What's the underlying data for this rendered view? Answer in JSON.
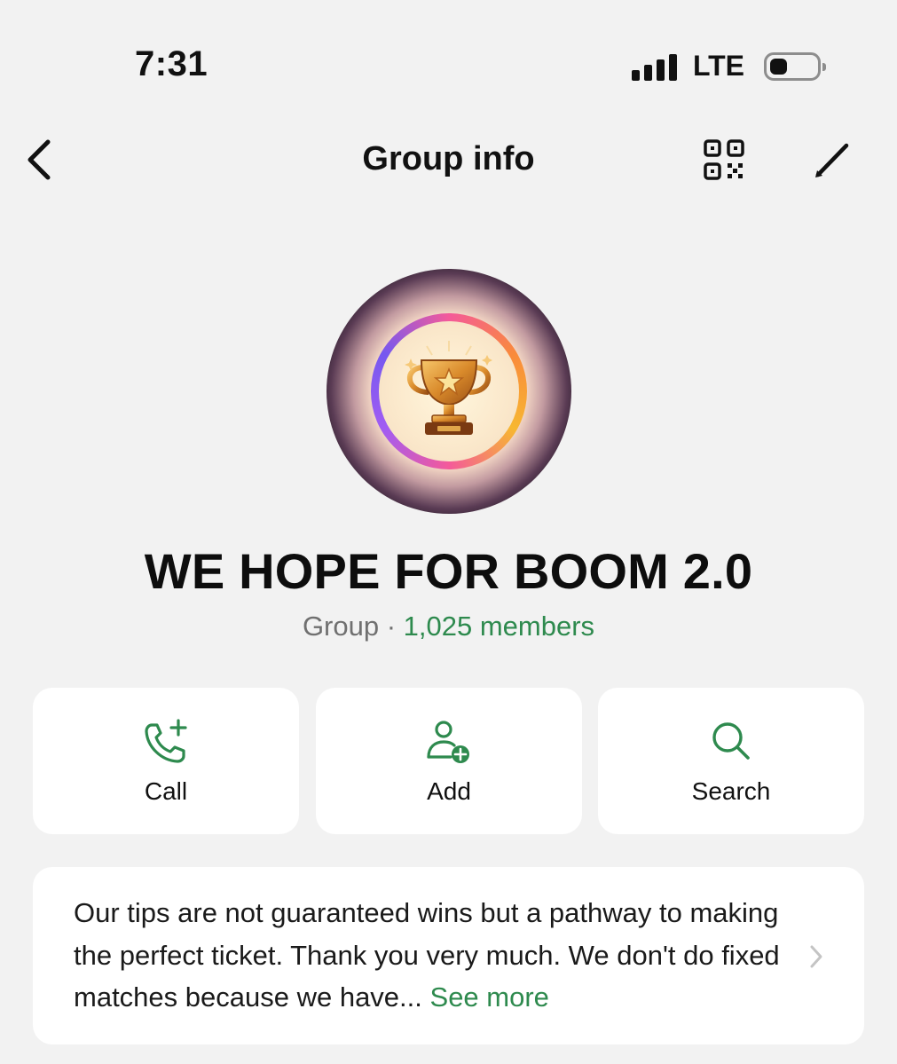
{
  "status_bar": {
    "time": "7:31",
    "network": "LTE"
  },
  "header": {
    "title": "Group info",
    "back_icon": "chevron-left-icon",
    "qr_icon": "qr-code-icon",
    "edit_icon": "pencil-icon"
  },
  "group": {
    "name": "WE HOPE FOR BOOM 2.0",
    "type_label": "Group",
    "separator": " · ",
    "members": "1,025 members",
    "avatar_icon": "trophy-icon"
  },
  "actions": [
    {
      "label": "Call",
      "icon": "phone-add-icon"
    },
    {
      "label": "Add",
      "icon": "add-person-icon"
    },
    {
      "label": "Search",
      "icon": "search-icon"
    }
  ],
  "description": {
    "text": "Our tips are not guaranteed wins but a pathway to making the perfect ticket. Thank you very much. We don't do fixed matches because we have...",
    "see_more": "See more"
  },
  "colors": {
    "accent": "#2e8a4e",
    "background": "#f2f2f2",
    "card": "#ffffff",
    "muted_text": "#707070"
  }
}
